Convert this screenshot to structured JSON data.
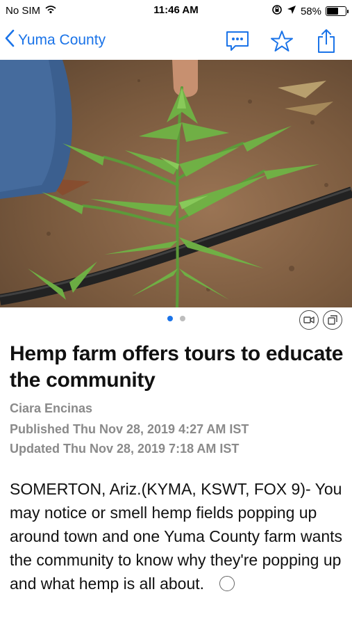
{
  "status_bar": {
    "carrier": "No SIM",
    "time": "11:46 AM",
    "battery_percent": "58%",
    "battery_level": 0.58
  },
  "nav": {
    "back_label": "Yuma County",
    "icons": [
      "back-chevron-icon",
      "comments-icon",
      "star-icon",
      "share-icon"
    ],
    "accent_color": "#1a73e8"
  },
  "gallery": {
    "page_count": 2,
    "active_page": 1,
    "icons": [
      "video-icon",
      "gallery-icon"
    ]
  },
  "article": {
    "headline": "Hemp farm offers tours to educate the community",
    "author": "Ciara Encinas",
    "published": "Published Thu Nov 28, 2019 4:27 AM IST",
    "updated": "Updated Thu Nov 28, 2019 7:18 AM IST",
    "body": "SOMERTON, Ariz.(KYMA, KSWT, FOX 9)- You may notice or smell hemp fields popping up around town and one Yuma County farm wants the community to know why they're popping up and what hemp is all about."
  }
}
